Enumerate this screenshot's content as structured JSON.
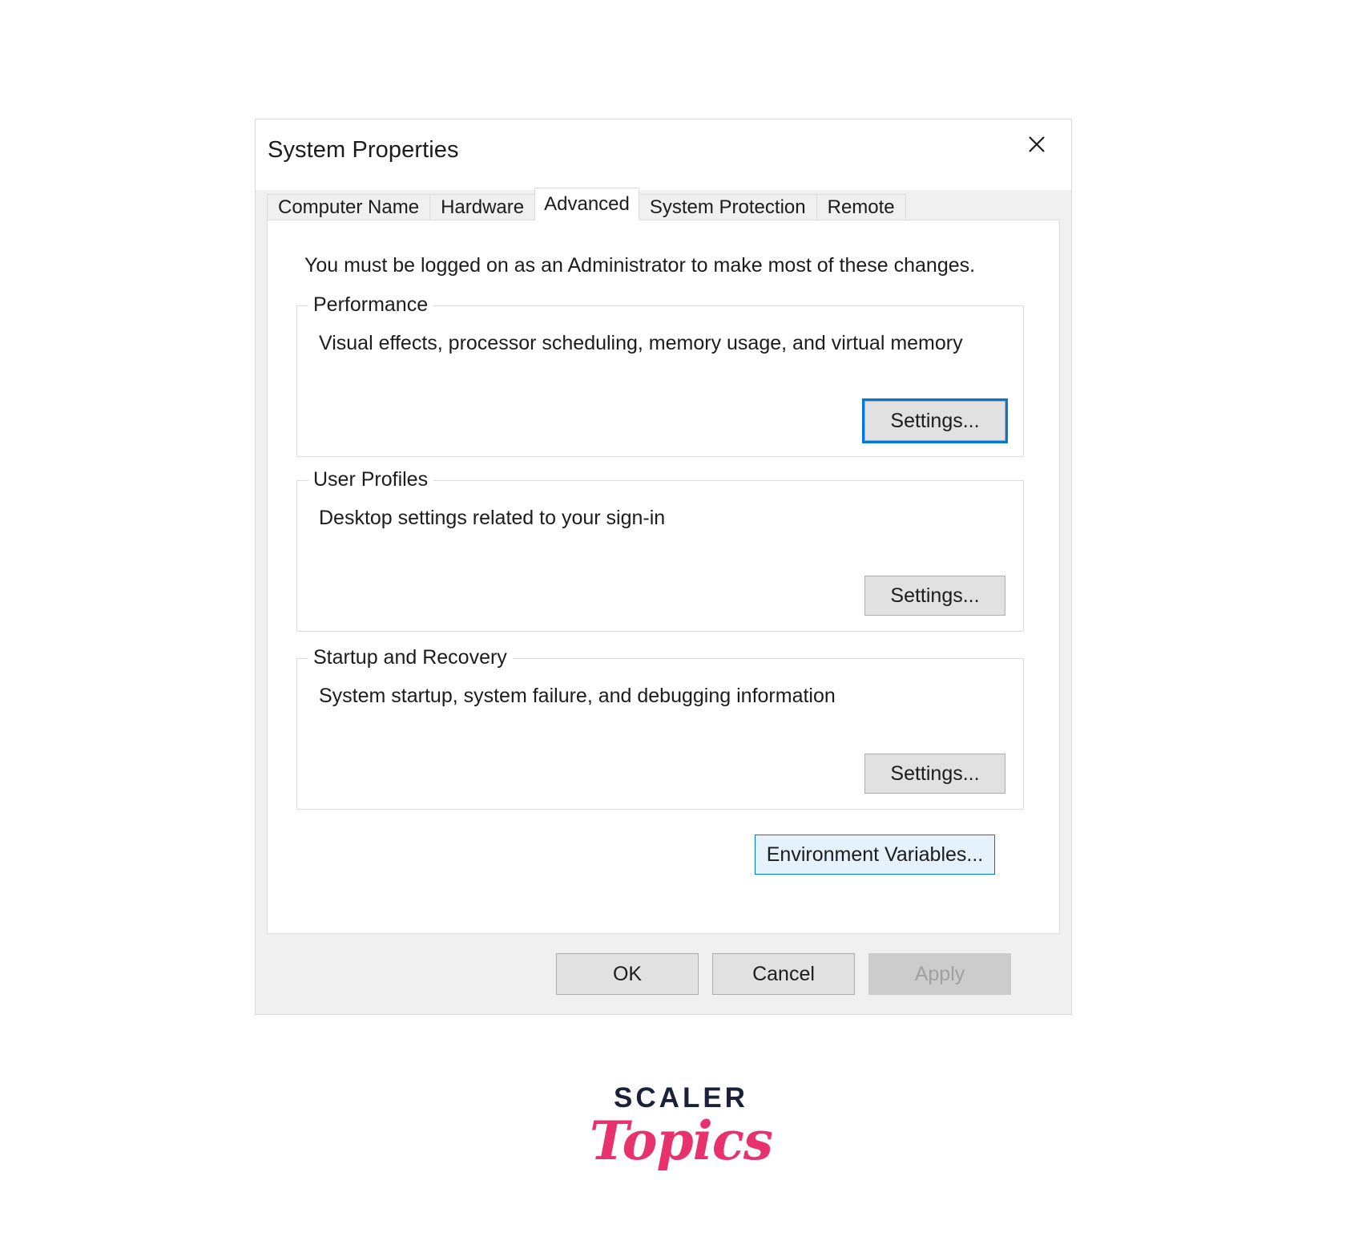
{
  "dialog": {
    "title": "System Properties",
    "close_icon": "close-icon",
    "tabs": [
      {
        "label": "Computer Name",
        "active": false
      },
      {
        "label": "Hardware",
        "active": false
      },
      {
        "label": "Advanced",
        "active": true
      },
      {
        "label": "System Protection",
        "active": false
      },
      {
        "label": "Remote",
        "active": false
      }
    ],
    "advanced_page": {
      "admin_note": "You must be logged on as an Administrator to make most of these changes.",
      "groups": [
        {
          "title": "Performance",
          "description": "Visual effects, processor scheduling, memory usage, and virtual memory",
          "button_label": "Settings...",
          "button_state": "focused"
        },
        {
          "title": "User Profiles",
          "description": "Desktop settings related to your sign-in",
          "button_label": "Settings...",
          "button_state": "normal"
        },
        {
          "title": "Startup and Recovery",
          "description": "System startup, system failure, and debugging information",
          "button_label": "Settings...",
          "button_state": "normal"
        }
      ],
      "environment_variables_button": {
        "label": "Environment Variables...",
        "state": "hovered"
      }
    },
    "footer": {
      "ok_label": "OK",
      "cancel_label": "Cancel",
      "apply_label": "Apply",
      "apply_enabled": false
    }
  },
  "watermark": {
    "line1": "SCALER",
    "line2": "Topics"
  },
  "colors": {
    "accent_blue": "#0078d7",
    "hover_blue_fill": "#e5f1fb",
    "dialog_bg": "#f0f0f0",
    "page_bg": "#ffffff",
    "border_gray": "#dcdcdc",
    "button_face": "#e1e1e1",
    "button_border": "#adadad",
    "disabled_face": "#cccccc",
    "disabled_text": "#a0a0a0",
    "text": "#1c1c1c",
    "logo_navy": "#1b2138",
    "logo_pink": "#e8326e"
  }
}
